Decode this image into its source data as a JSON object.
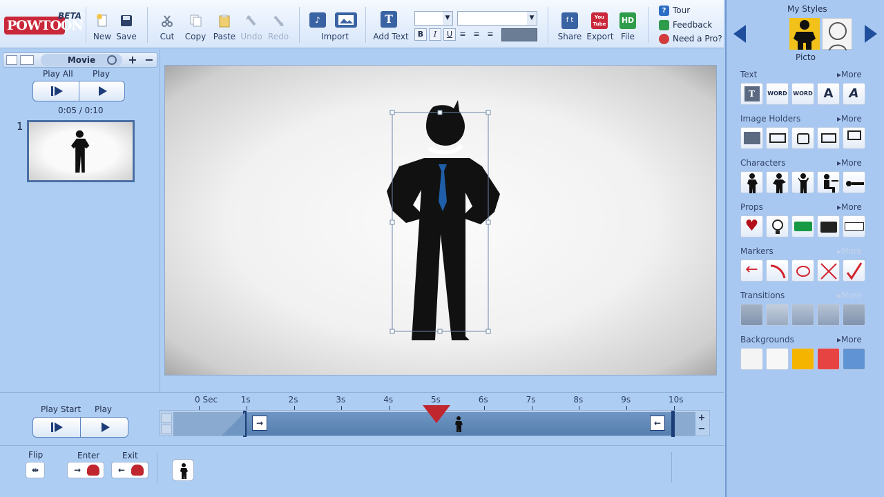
{
  "toolbar": {
    "logo": "POWTOON",
    "beta": "BETA",
    "new": "New",
    "save": "Save",
    "cut": "Cut",
    "copy": "Copy",
    "paste": "Paste",
    "undo": "Undo",
    "redo": "Redo",
    "import": "Import",
    "add_text": "Add Text",
    "bold": "B",
    "italic": "I",
    "underline": "U",
    "share": "Share",
    "export": "Export",
    "file": "File",
    "youtube": "You Tube",
    "hd": "HD",
    "tour": "Tour",
    "feedback": "Feedback",
    "need_pro": "Need a Pro?"
  },
  "left": {
    "movie_tab": "Movie",
    "play_all": "Play All",
    "play": "Play",
    "time": "0:05 / 0:10",
    "slide_number": "1"
  },
  "right": {
    "my_styles": "My Styles",
    "style_name": "Picto",
    "sections": [
      {
        "title": "Text",
        "more": "More"
      },
      {
        "title": "Image Holders",
        "more": "More"
      },
      {
        "title": "Characters",
        "more": "More"
      },
      {
        "title": "Props",
        "more": "More"
      },
      {
        "title": "Markers",
        "more": "More"
      },
      {
        "title": "Transitions",
        "more": "More"
      },
      {
        "title": "Backgrounds",
        "more": "More"
      }
    ],
    "word_tiles": [
      "WORD",
      "WORD",
      "A",
      "A"
    ],
    "background_colors": [
      "#f4f4f4",
      "#f7f7f7",
      "#f4b400",
      "#e84343",
      "#5f93d3"
    ]
  },
  "timeline": {
    "play_start": "Play Start",
    "play": "Play",
    "ticks": [
      "0 Sec",
      "1s",
      "2s",
      "3s",
      "4s",
      "5s",
      "6s",
      "7s",
      "8s",
      "9s",
      "10s"
    ],
    "playhead_seconds": 5,
    "flip": "Flip",
    "enter": "Enter",
    "exit": "Exit"
  }
}
